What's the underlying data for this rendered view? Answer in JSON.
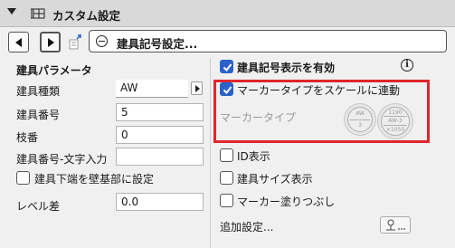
{
  "titlebar": {
    "title": "カスタム設定",
    "collapse_icon": "triangle-down-icon",
    "title_icon": "dimension-grid-icon"
  },
  "nav": {
    "prev_icon": "triangle-left-icon",
    "next_icon": "triangle-right-icon",
    "transfer_icon": "settings-transfer-icon",
    "selector_icon": "minus-circle-icon",
    "selector_label": "建具記号設定..."
  },
  "left": {
    "section_title": "建具パラメータ",
    "params": [
      {
        "label": "建具種類",
        "value": "AW"
      },
      {
        "label": "建具番号",
        "value": "5"
      },
      {
        "label": "枝番",
        "value": "0"
      },
      {
        "label": "建具番号-文字入力",
        "value": ""
      }
    ],
    "checkbox_wall_base": {
      "label": "建具下端を壁基部に設定",
      "checked": false
    },
    "level_label": "レベル差",
    "level_value": "0.0"
  },
  "right": {
    "enable_symbol": {
      "label": "建具記号表示を有効",
      "checked": true
    },
    "link_marker_scale": {
      "label": "マーカータイプをスケールに連動",
      "checked": true
    },
    "marker_type_label": "マーカータイプ",
    "marker_a": {
      "top": "AW",
      "bottom": "3"
    },
    "marker_b": {
      "top": "1190",
      "middle": "AW-3",
      "bottom": "×1050"
    },
    "id_display": {
      "label": "ID表示",
      "checked": false
    },
    "size_display": {
      "label": "建具サイズ表示",
      "checked": false
    },
    "marker_fill": {
      "label": "マーカー塗りつぶし",
      "checked": false
    },
    "additional_settings": "追加設定...",
    "additional_settings_icon": "pin-settings-icon",
    "info_icon": "info-icon",
    "info_glyph": "i"
  },
  "colors": {
    "accent": "#2a62c9",
    "highlight": "#e0262a",
    "titlebar_bg": "#d9d9d9",
    "panel_bg": "#f0f0f0"
  }
}
